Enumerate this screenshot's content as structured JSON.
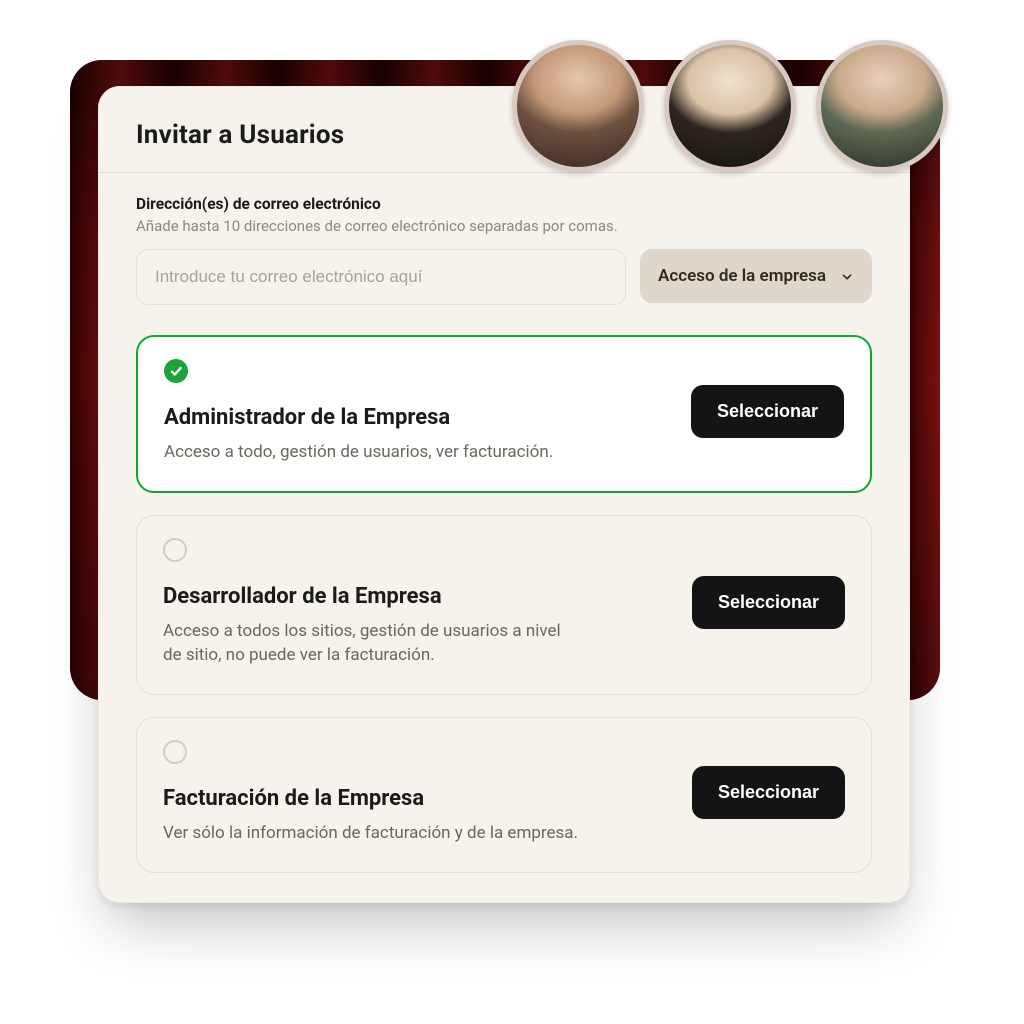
{
  "modal": {
    "title": "Invitar a Usuarios",
    "email_label": "Dirección(es) de correo electrónico",
    "email_hint": "Añade hasta 10 direcciones de correo electrónico separadas por comas.",
    "email_placeholder": "Introduce tu correo electrónico aquí",
    "access_select": {
      "label": "Acceso de la empresa"
    }
  },
  "roles": [
    {
      "title": "Administrador de la Empresa",
      "description": "Acceso a todo, gestión de usuarios, ver facturación.",
      "button": "Seleccionar",
      "selected": true
    },
    {
      "title": "Desarrollador de la Empresa",
      "description": "Acceso a todos los sitios, gestión de usuarios a nivel de sitio, no puede ver la facturación.",
      "button": "Seleccionar",
      "selected": false
    },
    {
      "title": "Facturación de la Empresa",
      "description": "Ver sólo la información de facturación y de la empresa.",
      "button": "Seleccionar",
      "selected": false
    }
  ],
  "colors": {
    "accent_green": "#1ea23a",
    "cream_bg": "#f6f3ed",
    "select_button": "#141414"
  }
}
